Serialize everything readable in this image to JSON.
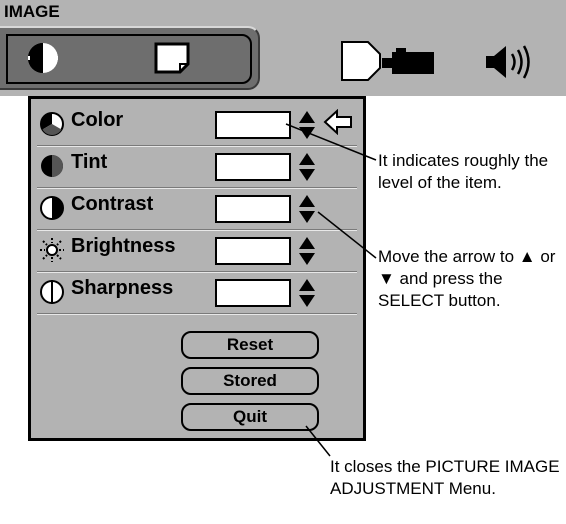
{
  "menu": {
    "title": "IMAGE",
    "tabs": [
      {
        "name": "image-adjust",
        "icon": "half-circle-icon",
        "selected": true
      },
      {
        "name": "screen",
        "icon": "screen-icon",
        "selected": false
      },
      {
        "name": "projector",
        "icon": "projector-icon",
        "selected": false
      },
      {
        "name": "sound",
        "icon": "speaker-icon",
        "selected": false
      }
    ]
  },
  "panel": {
    "items": [
      {
        "label": "Color",
        "icon": "color-wheel-icon"
      },
      {
        "label": "Tint",
        "icon": "half-circle-icon"
      },
      {
        "label": "Contrast",
        "icon": "contrast-icon"
      },
      {
        "label": "Brightness",
        "icon": "sun-icon"
      },
      {
        "label": "Sharpness",
        "icon": "sharpness-icon"
      }
    ],
    "pointer_icon": "arrow-left-icon",
    "buttons": {
      "reset": "Reset",
      "stored": "Stored",
      "quit": "Quit"
    }
  },
  "annotations": {
    "level": "It indicates roughly the level of the item.",
    "arrow": "Move the arrow to ▲ or ▼ and press the SELECT button.",
    "quit": "It closes the PICTURE IMAGE ADJUSTMENT Menu."
  },
  "colors": {
    "menu_bg": "#b3b3b3",
    "iconbar_bg": "#6e6e6e",
    "value_box": "#ffffff"
  }
}
